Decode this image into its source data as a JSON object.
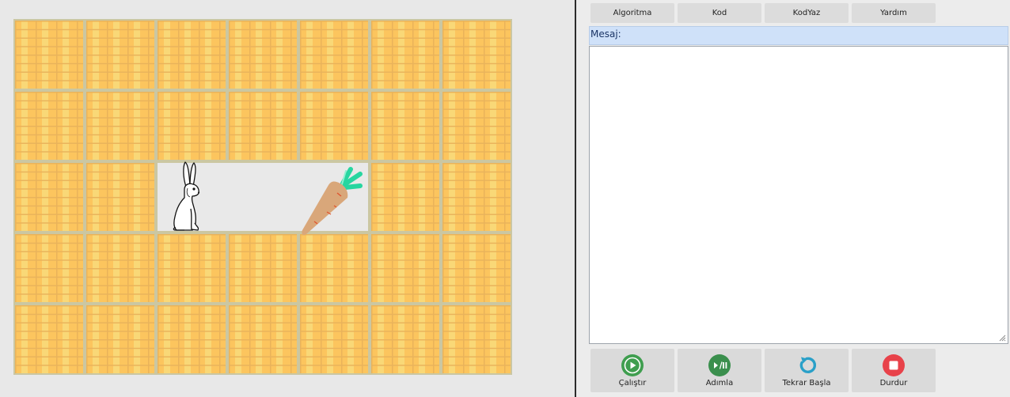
{
  "toolbar": {
    "tabs": [
      {
        "label": "Algoritma"
      },
      {
        "label": "Kod"
      },
      {
        "label": "KodYaz"
      },
      {
        "label": "Yardım"
      }
    ]
  },
  "message": {
    "label": "Mesaj:",
    "content": ""
  },
  "controls": [
    {
      "label": "Çalıştır",
      "icon": "play-icon",
      "color": "#3f9e4f"
    },
    {
      "label": "Adımla",
      "icon": "step-icon",
      "color": "#3a8f4d"
    },
    {
      "label": "Tekrar Başla",
      "icon": "restart-icon",
      "color": "#2aa0c8"
    },
    {
      "label": "Durdur",
      "icon": "stop-icon",
      "color": "#e8424a"
    }
  ],
  "maze": {
    "rows": 5,
    "cols": 7,
    "open_cells": [
      [
        2,
        2
      ],
      [
        2,
        3
      ],
      [
        2,
        4
      ]
    ],
    "rabbit": [
      2,
      2
    ],
    "carrot": [
      2,
      4
    ],
    "colors": {
      "wall": "#fcc55e",
      "grout": "#cbc7a2",
      "path": "#e9e9e9"
    }
  }
}
